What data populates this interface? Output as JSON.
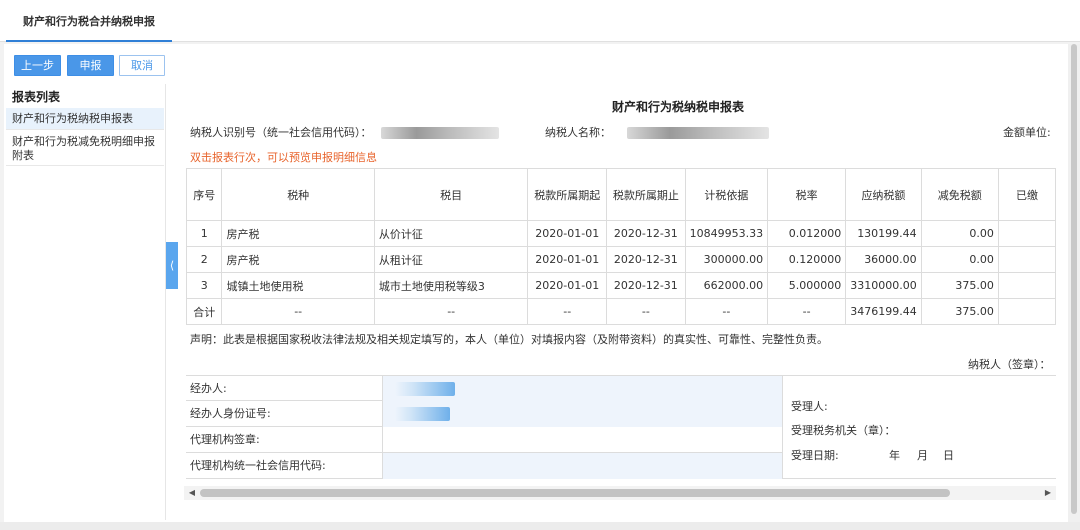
{
  "tab": {
    "label": "财产和行为税合并纳税申报"
  },
  "toolbar": {
    "prev_label": "上一步",
    "declare_label": "申报",
    "cancel_label": "取消"
  },
  "sidebar": {
    "title": "报表列表",
    "items": [
      {
        "label": "财产和行为税纳税申报表",
        "active": true
      },
      {
        "label": "财产和行为税减免税明细申报附表",
        "active": false
      }
    ],
    "collapse_icon": "chevron-left-icon"
  },
  "form": {
    "title": "财产和行为税纳税申报表",
    "taxpayer_id_label": "纳税人识别号（统一社会信用代码）：",
    "taxpayer_name_label": "纳税人名称：",
    "amount_unit_label": "金额单位:",
    "hint": "双击报表行次，可以预览申报明细信息",
    "columns": [
      "序号",
      "税种",
      "税目",
      "税款所属期起",
      "税款所属期止",
      "计税依据",
      "税率",
      "应纳税额",
      "减免税额",
      "已缴"
    ],
    "rows": [
      [
        "1",
        "房产税",
        "从价计征",
        "2020-01-01",
        "2020-12-31",
        "10849953.33",
        "0.012000",
        "130199.44",
        "0.00",
        ""
      ],
      [
        "2",
        "房产税",
        "从租计征",
        "2020-01-01",
        "2020-12-31",
        "300000.00",
        "0.120000",
        "36000.00",
        "0.00",
        ""
      ],
      [
        "3",
        "城镇土地使用税",
        "城市土地使用税等级3",
        "2020-01-01",
        "2020-12-31",
        "662000.00",
        "5.000000",
        "3310000.00",
        "375.00",
        ""
      ]
    ],
    "total_row": [
      "合计",
      "--",
      "--",
      "--",
      "--",
      "--",
      "--",
      "3476199.44",
      "375.00",
      ""
    ],
    "declaration": "声明：此表是根据国家税收法律法规及相关规定填写的，本人（单位）对填报内容（及附带资料）的真实性、可靠性、完整性负责。",
    "signature": "纳税人（签章）：",
    "agent_label": "经办人:",
    "agent_id_label": "经办人身份证号:",
    "agency_seal_label": "代理机构签章:",
    "agency_credit_label": "代理机构统一社会信用代码:",
    "receiver_label": "受理人:",
    "tax_office_label": "受理税务机关（章）：",
    "receive_date_label": "受理日期:",
    "date_year": "年",
    "date_month": "月",
    "date_day": "日"
  },
  "colors": {
    "accent": "#4a97e8",
    "hint": "#e8642c",
    "active_item_bg": "#e8f2fc"
  }
}
